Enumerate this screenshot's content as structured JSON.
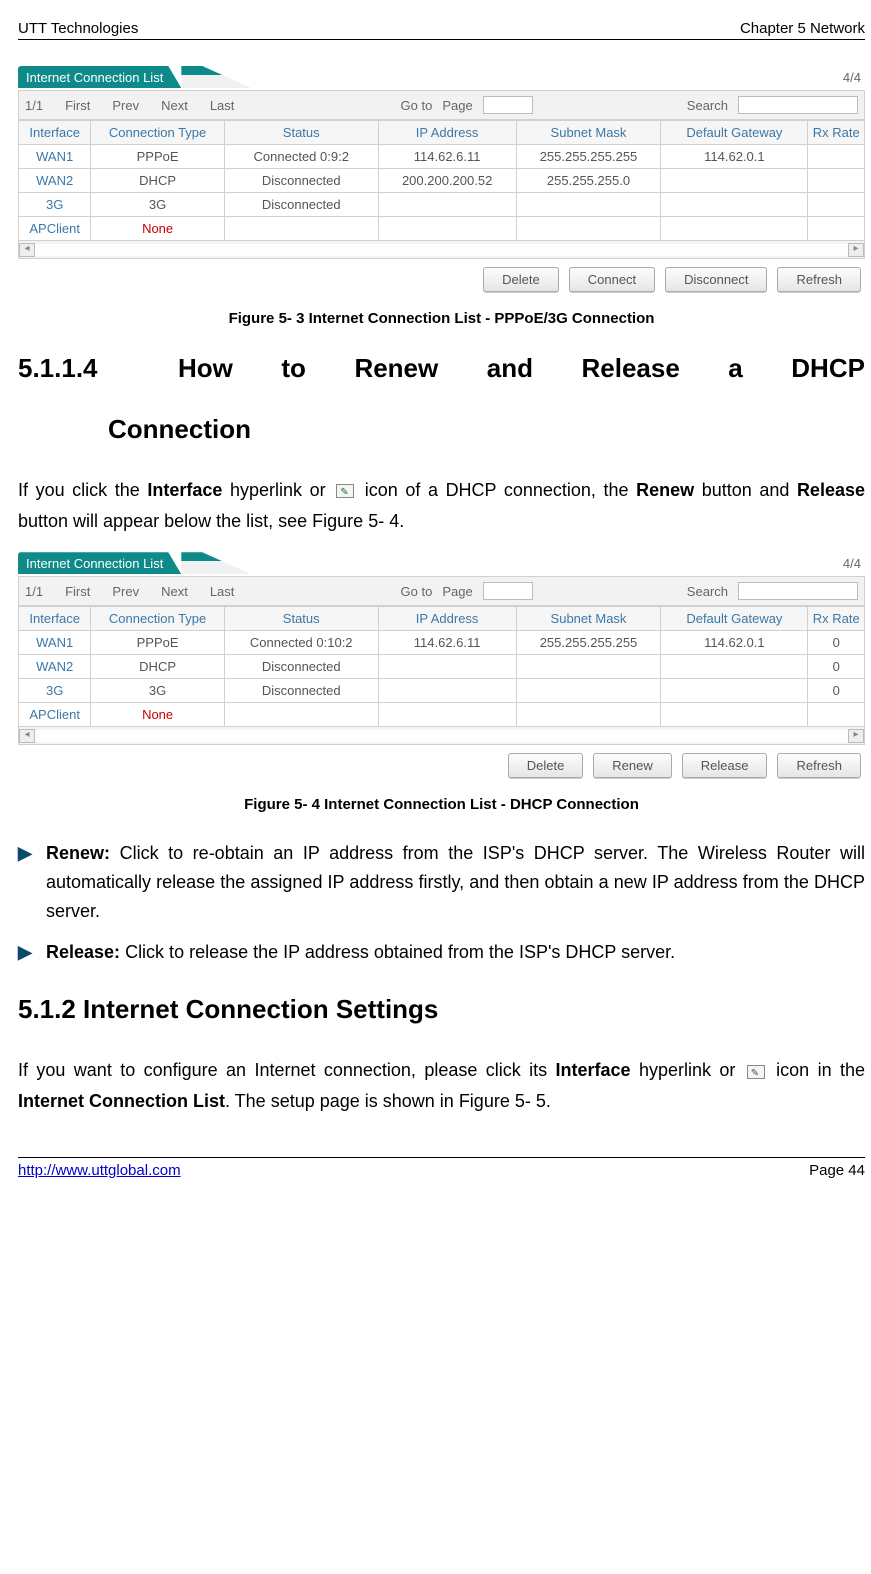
{
  "header": {
    "left": "UTT Technologies",
    "right": "Chapter 5 Network"
  },
  "figure1": {
    "title": "Internet Connection List",
    "count": "4/4",
    "toolbar": {
      "pager": "1/1",
      "first": "First",
      "prev": "Prev",
      "next": "Next",
      "last": "Last",
      "goto": "Go to",
      "page": "Page",
      "search": "Search"
    },
    "columns": [
      "Interface",
      "Connection Type",
      "Status",
      "IP Address",
      "Subnet Mask",
      "Default Gateway",
      "Rx Rate"
    ],
    "rows": [
      {
        "iface": "WAN1",
        "type": "PPPoE",
        "status": "Connected 0:9:2",
        "ip": "114.62.6.11",
        "mask": "255.255.255.255",
        "gw": "114.62.0.1",
        "rx": ""
      },
      {
        "iface": "WAN2",
        "type": "DHCP",
        "status": "Disconnected",
        "ip": "200.200.200.52",
        "mask": "255.255.255.0",
        "gw": "",
        "rx": ""
      },
      {
        "iface": "3G",
        "type": "3G",
        "status": "Disconnected",
        "ip": "",
        "mask": "",
        "gw": "",
        "rx": ""
      },
      {
        "iface": "APClient",
        "type": "None",
        "status": "",
        "ip": "",
        "mask": "",
        "gw": "",
        "rx": "",
        "none": true
      }
    ],
    "buttons": [
      "Delete",
      "Connect",
      "Disconnect",
      "Refresh"
    ],
    "caption": "Figure 5- 3 Internet Connection List - PPPoE/3G Connection"
  },
  "section5114": {
    "num": "5.1.1.4",
    "words": [
      "How",
      "to",
      "Renew",
      "and",
      "Release",
      "a",
      "DHCP"
    ],
    "line2": "Connection"
  },
  "para1": {
    "pre": "If you click the ",
    "b1": "Interface",
    "mid1": " hyperlink or ",
    "mid2": " icon of a DHCP connection, the ",
    "b2": "Renew",
    "mid3": " button and ",
    "b3": "Release",
    "post": " button will appear below the list, see Figure 5- 4."
  },
  "figure2": {
    "title": "Internet Connection List",
    "count": "4/4",
    "toolbar": {
      "pager": "1/1",
      "first": "First",
      "prev": "Prev",
      "next": "Next",
      "last": "Last",
      "goto": "Go to",
      "page": "Page",
      "search": "Search"
    },
    "columns": [
      "Interface",
      "Connection Type",
      "Status",
      "IP Address",
      "Subnet Mask",
      "Default Gateway",
      "Rx Rate"
    ],
    "rows": [
      {
        "iface": "WAN1",
        "type": "PPPoE",
        "status": "Connected 0:10:2",
        "ip": "114.62.6.11",
        "mask": "255.255.255.255",
        "gw": "114.62.0.1",
        "rx": "0"
      },
      {
        "iface": "WAN2",
        "type": "DHCP",
        "status": "Disconnected",
        "ip": "",
        "mask": "",
        "gw": "",
        "rx": "0"
      },
      {
        "iface": "3G",
        "type": "3G",
        "status": "Disconnected",
        "ip": "",
        "mask": "",
        "gw": "",
        "rx": "0"
      },
      {
        "iface": "APClient",
        "type": "None",
        "status": "",
        "ip": "",
        "mask": "",
        "gw": "",
        "rx": "",
        "none": true
      }
    ],
    "buttons": [
      "Delete",
      "Renew",
      "Release",
      "Refresh"
    ],
    "caption": "Figure 5- 4 Internet Connection List - DHCP Connection"
  },
  "bullets": [
    {
      "label": "Renew:",
      "text": " Click to re-obtain an IP address from the ISP's DHCP server. The Wireless Router will automatically release the assigned IP address firstly, and then obtain a new IP address from the DHCP server."
    },
    {
      "label": "Release:",
      "text": " Click to release the IP address obtained from the ISP's DHCP server."
    }
  ],
  "section512": "5.1.2    Internet Connection Settings",
  "para2": {
    "pre": "If you want to configure an Internet connection, please click its ",
    "b1": "Interface",
    "mid1": " hyperlink or ",
    "mid2": " icon in the ",
    "b2": "Internet Connection List",
    "post": ". The setup page is shown in Figure 5- 5."
  },
  "footer": {
    "url": "http://www.uttglobal.com",
    "page": "Page 44"
  }
}
